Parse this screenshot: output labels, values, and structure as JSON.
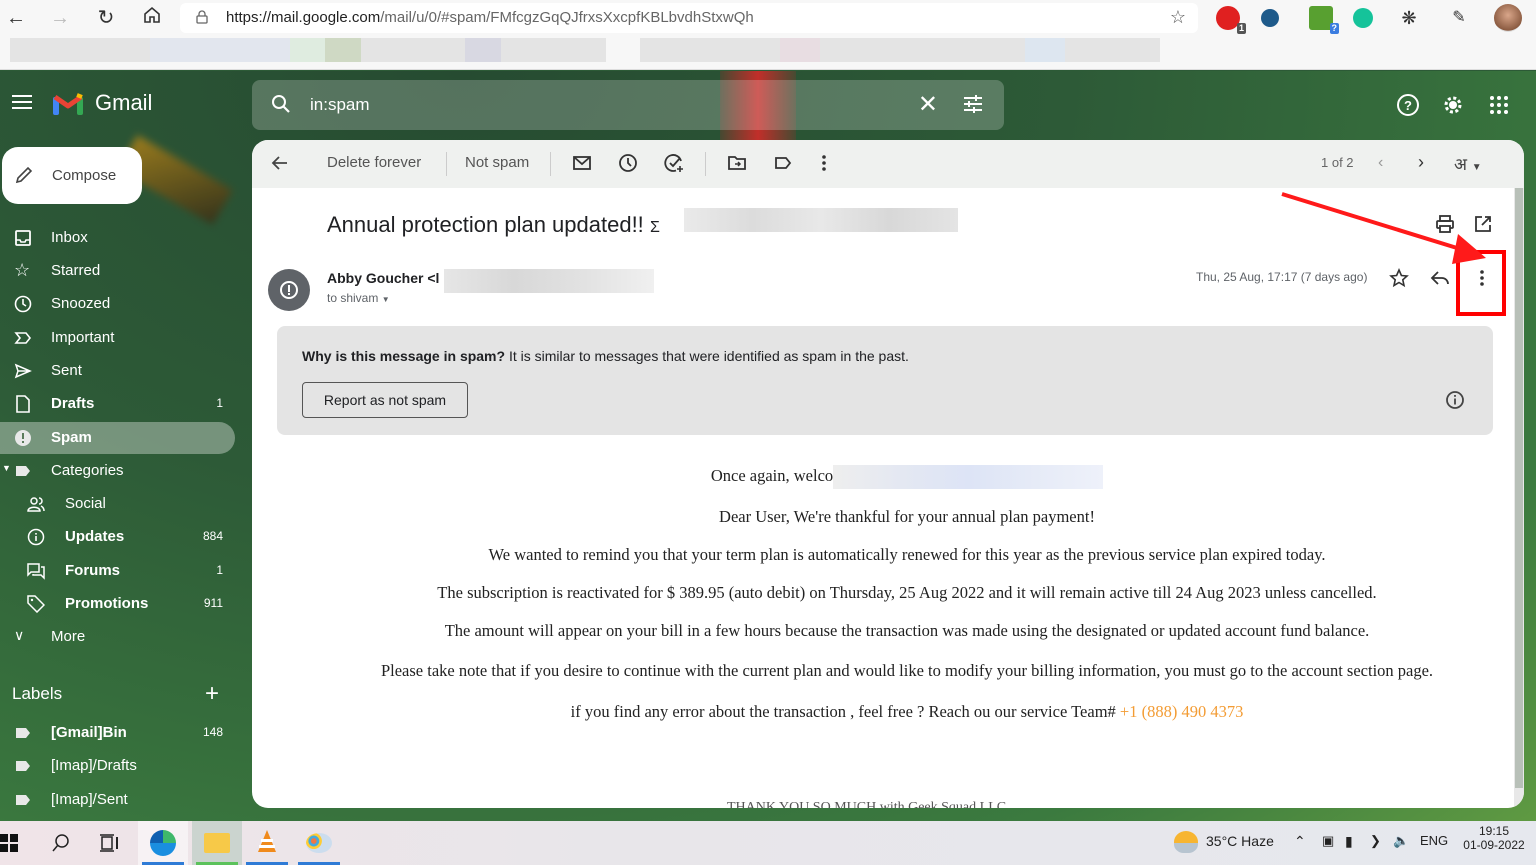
{
  "browser": {
    "url_host": "https://mail.google.com",
    "url_path": "/mail/u/0/#spam/FMfcgzGqQJfrxsXxcpfKBLbvdhStxwQh",
    "extensions": [
      {
        "name": "ext-red-badge",
        "badge": "1",
        "color": "#e02020",
        "badge_color": "#555555"
      },
      {
        "name": "ext-blue",
        "color": "#1e5a8a"
      },
      {
        "name": "ext-green-download",
        "badge": "?",
        "color": "#58a030",
        "badge_color": "#3b7de0"
      },
      {
        "name": "ext-grammarly",
        "color": "#15c39a"
      }
    ]
  },
  "gmail": {
    "logo_text": "Gmail",
    "search": {
      "value": "in:spam"
    },
    "compose_label": "Compose",
    "nav": [
      {
        "label": "Inbox",
        "icon": "inbox-icon",
        "count": ""
      },
      {
        "label": "Starred",
        "icon": "star-icon",
        "count": ""
      },
      {
        "label": "Snoozed",
        "icon": "clock-icon",
        "count": ""
      },
      {
        "label": "Important",
        "icon": "important-icon",
        "count": ""
      },
      {
        "label": "Sent",
        "icon": "send-icon",
        "count": ""
      },
      {
        "label": "Drafts",
        "icon": "draft-icon",
        "count": "1",
        "bold": true
      },
      {
        "label": "Spam",
        "icon": "spam-icon",
        "count": "",
        "active": true
      },
      {
        "label": "Categories",
        "icon": "label-icon",
        "count": ""
      }
    ],
    "categories": [
      {
        "label": "Social",
        "icon": "people-icon",
        "count": ""
      },
      {
        "label": "Updates",
        "icon": "info-icon",
        "count": "884"
      },
      {
        "label": "Forums",
        "icon": "forum-icon",
        "count": "1"
      },
      {
        "label": "Promotions",
        "icon": "tag-icon",
        "count": "911"
      }
    ],
    "more_label": "More",
    "labels_heading": "Labels",
    "labels": [
      {
        "label": "[Gmail]Bin",
        "count": "148",
        "bold": true
      },
      {
        "label": "[Imap]/Drafts",
        "count": ""
      },
      {
        "label": "[Imap]/Sent",
        "count": ""
      }
    ]
  },
  "toolbar": {
    "delete_forever": "Delete forever",
    "not_spam": "Not spam",
    "pager": "1 of 2",
    "input_tool": "अ"
  },
  "email": {
    "subject": "Annual protection plan updated!!",
    "subject_suffix": "Σ",
    "sender_name": "Abby Goucher <l",
    "to": "to shivam",
    "date": "Thu, 25 Aug, 17:17 (7 days ago)",
    "spam_why_bold": "Why is this message in spam?",
    "spam_why_text": " It is similar to messages that were identified as spam in the past.",
    "report_not_spam": "Report as not spam",
    "body": {
      "welcome": "Once again, welco",
      "p1": "Dear User, We're thankful for your annual plan payment!",
      "p2": "We wanted to remind you that your term plan is automatically renewed for this year as the previous service plan expired today.",
      "p3": "The subscription is reactivated for $ 389.95 (auto debit) on Thursday, 25 Aug 2022 and it will remain active till 24 Aug 2023 unless cancelled.",
      "p4": "The amount will appear on your bill in a few hours because the transaction was made using the designated or updated account fund balance.",
      "p5": "Please take note that if you desire to continue with the current plan and would like to modify your billing information, you must go to the account section page.",
      "p6": "if you find any error about the transaction , feel free ? Reach ou our service Team# ",
      "phone": "+1 (888) 490 4373",
      "cut_line": "THANK YOU SO MUCH with Geek Squad LLC"
    }
  },
  "taskbar": {
    "weather": "35°C  Haze",
    "lang": "ENG",
    "time": "19:15",
    "date": "01-09-2022"
  },
  "colors": {
    "highlight": "#ff0000",
    "phone": "#f39c34"
  }
}
